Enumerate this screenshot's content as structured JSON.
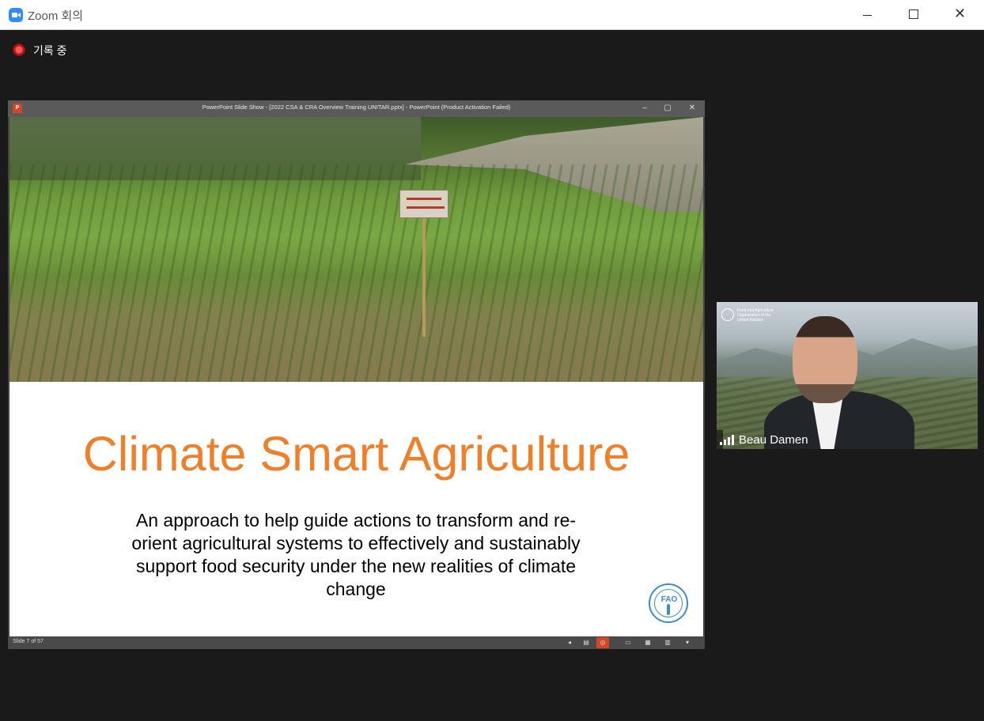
{
  "window": {
    "title": "Zoom 회의",
    "minimize_icon": "minimize-icon",
    "maximize_icon": "maximize-icon",
    "close_icon": "close-icon",
    "close_glyph": "✕"
  },
  "recording": {
    "label": "기록 중",
    "icon": "recording-dot-icon",
    "color": "#e02020"
  },
  "powerpoint": {
    "app_icon_label": "P",
    "title": "PowerPoint Slide Show - [2022 CSA & CRA Overview Training UNITAR.pptx] - PowerPoint (Product Activation Failed)",
    "controls": [
      "–",
      "▢",
      "✕"
    ],
    "slide": {
      "title": "Climate Smart Agriculture",
      "subtitle": "An approach to help guide actions to transform and re-orient agricultural systems to effectively and sustainably support food security under the new realities of climate change",
      "logo_text": "FAO",
      "title_color": "#f07f2a"
    },
    "status": {
      "slide_counter": "Slide 7 of 57",
      "icons": [
        "previous-icon",
        "notes-icon",
        "pointer-options-icon",
        "normal-view-icon",
        "slide-sorter-icon",
        "reading-view-icon",
        "slideshow-menu-icon"
      ]
    }
  },
  "participant": {
    "name": "Beau Damen",
    "logo_caption": "Food and Agriculture Organization of the United Nations"
  }
}
